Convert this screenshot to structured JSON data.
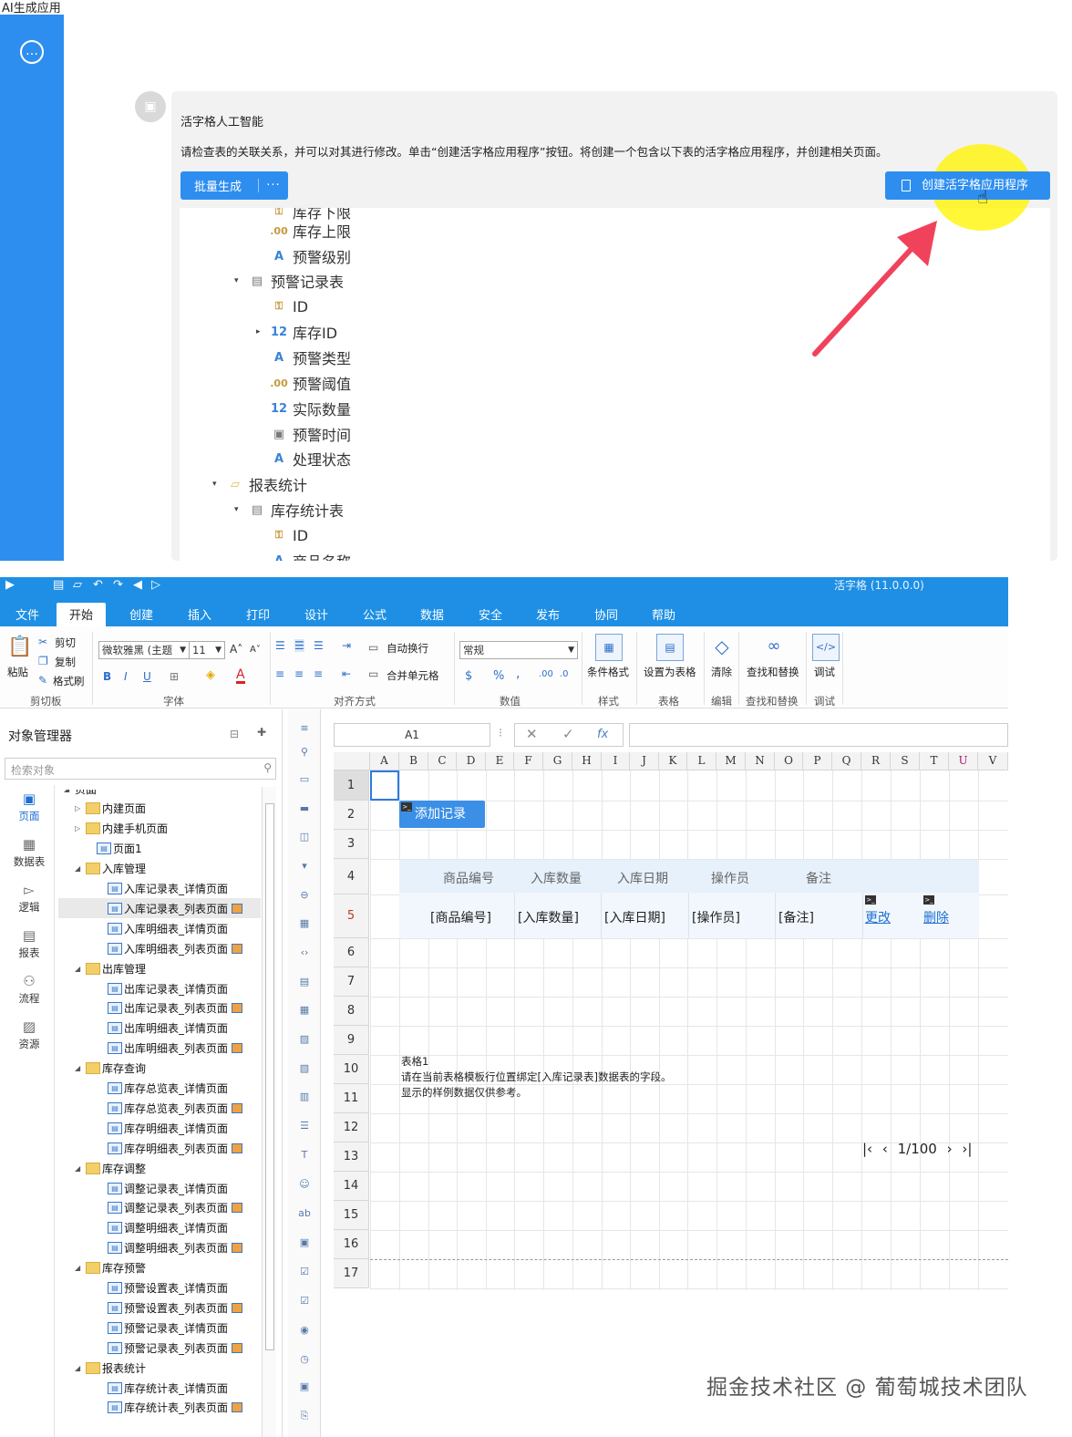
{
  "ai": {
    "app_title": "AI生成应用",
    "bubble_title": "活字格人工智能",
    "bubble_desc": "请检查表的关联关系，并可以对其进行修改。单击“创建活字格应用程序”按钮。将创建一个包含以下表的活字格应用程序，并创建相关页面。",
    "batch_button": "批量生成",
    "batch_more": "···",
    "create_button": "创建活字格应用程序",
    "tree": [
      {
        "label": "库存下限",
        "icon": "key"
      },
      {
        "label": "库存上限",
        "icon": "dec"
      },
      {
        "label": "预警级别",
        "icon": "A"
      },
      {
        "label": "预警记录表",
        "icon": "table"
      },
      {
        "label": "ID",
        "icon": "key"
      },
      {
        "label": "库存ID",
        "icon": "12"
      },
      {
        "label": "预警类型",
        "icon": "A"
      },
      {
        "label": "预警阈值",
        "icon": "dec"
      },
      {
        "label": "实际数量",
        "icon": "12"
      },
      {
        "label": "预警时间",
        "icon": "date"
      },
      {
        "label": "处理状态",
        "icon": "A"
      },
      {
        "label": "报表统计",
        "icon": "folder"
      },
      {
        "label": "库存统计表",
        "icon": "table"
      },
      {
        "label": "ID",
        "icon": "key"
      },
      {
        "label": "商品名称",
        "icon": "A"
      }
    ]
  },
  "designer": {
    "app_version": "活字格 (11.0.0.0)",
    "tabs": [
      "文件",
      "开始",
      "创建",
      "插入",
      "打印",
      "设计",
      "公式",
      "数据",
      "安全",
      "发布",
      "协同",
      "帮助"
    ],
    "active_tab": "开始",
    "ribbon": {
      "paste": "粘贴",
      "cut": "剪切",
      "copy": "复制",
      "format_painter": "格式刷",
      "clipboard_group": "剪切板",
      "font_name": "微软雅黑 (主题",
      "font_size": "11",
      "bold": "B",
      "italic": "I",
      "underline": "U",
      "font_color_letter": "A",
      "font_group": "字体",
      "wrap": "自动换行",
      "merge": "合并单元格",
      "align_group": "对齐方式",
      "number_format": "常规",
      "currency": "$",
      "percent": "%",
      "comma": ",",
      "number_group": "数值",
      "cond_format": "条件格式",
      "style_group": "样式",
      "set_table": "设置为表格",
      "table_group": "表格",
      "clear": "清除",
      "edit_group": "编辑",
      "find_replace": "查找和替换",
      "find_group": "查找和替换",
      "debug": "调试",
      "debug_group": "调试"
    },
    "object_manager": {
      "title": "对象管理器",
      "search_placeholder": "检索对象",
      "rail": [
        "页面",
        "数据表",
        "逻辑",
        "报表",
        "流程",
        "资源"
      ],
      "tree": [
        {
          "label": "页面",
          "type": "root"
        },
        {
          "label": "内建页面",
          "type": "folder"
        },
        {
          "label": "内建手机页面",
          "type": "folder"
        },
        {
          "label": "页面1",
          "type": "page"
        },
        {
          "label": "入库管理",
          "type": "folder"
        },
        {
          "label": "入库记录表_详情页面",
          "type": "page"
        },
        {
          "label": "入库记录表_列表页面",
          "type": "page"
        },
        {
          "label": "入库明细表_详情页面",
          "type": "page"
        },
        {
          "label": "入库明细表_列表页面",
          "type": "page"
        },
        {
          "label": "出库管理",
          "type": "folder"
        },
        {
          "label": "出库记录表_详情页面",
          "type": "page"
        },
        {
          "label": "出库记录表_列表页面",
          "type": "page"
        },
        {
          "label": "出库明细表_详情页面",
          "type": "page"
        },
        {
          "label": "出库明细表_列表页面",
          "type": "page"
        },
        {
          "label": "库存查询",
          "type": "folder"
        },
        {
          "label": "库存总览表_详情页面",
          "type": "page"
        },
        {
          "label": "库存总览表_列表页面",
          "type": "page"
        },
        {
          "label": "库存明细表_详情页面",
          "type": "page"
        },
        {
          "label": "库存明细表_列表页面",
          "type": "page"
        },
        {
          "label": "库存调整",
          "type": "folder"
        },
        {
          "label": "调整记录表_详情页面",
          "type": "page"
        },
        {
          "label": "调整记录表_列表页面",
          "type": "page"
        },
        {
          "label": "调整明细表_详情页面",
          "type": "page"
        },
        {
          "label": "调整明细表_列表页面",
          "type": "page"
        },
        {
          "label": "库存预警",
          "type": "folder"
        },
        {
          "label": "预警设置表_详情页面",
          "type": "page"
        },
        {
          "label": "预警设置表_列表页面",
          "type": "page"
        },
        {
          "label": "预警记录表_详情页面",
          "type": "page"
        },
        {
          "label": "预警记录表_列表页面",
          "type": "page"
        },
        {
          "label": "报表统计",
          "type": "folder"
        },
        {
          "label": "库存统计表_详情页面",
          "type": "page"
        },
        {
          "label": "库存统计表_列表页面",
          "type": "page"
        }
      ]
    },
    "name_box": "A1",
    "fx": "fx",
    "columns": [
      "A",
      "B",
      "C",
      "D",
      "E",
      "F",
      "G",
      "H",
      "I",
      "J",
      "K",
      "L",
      "M",
      "N",
      "O",
      "P",
      "Q",
      "R",
      "S",
      "T",
      "U",
      "V"
    ],
    "rows": [
      "1",
      "2",
      "3",
      "4",
      "5",
      "6",
      "7",
      "8",
      "9",
      "10",
      "11",
      "12",
      "13",
      "14",
      "15",
      "16",
      "17"
    ],
    "add_button": "添加记录",
    "table_headers": [
      "商品编号",
      "入库数量",
      "入库日期",
      "操作员",
      "备注"
    ],
    "table_row": [
      "[商品编号]",
      "[入库数量]",
      "[入库日期]",
      "[操作员]",
      "[备注]"
    ],
    "edit_link": "更改",
    "delete_link": "删除",
    "note_lines": [
      "表格1",
      "请在当前表格模板行位置绑定[入库记录表]数据表的字段。",
      "显示的样例数据仅供参考。"
    ],
    "pager": "1/100"
  },
  "watermark": "掘金技术社区 @ 葡萄城技术团队"
}
